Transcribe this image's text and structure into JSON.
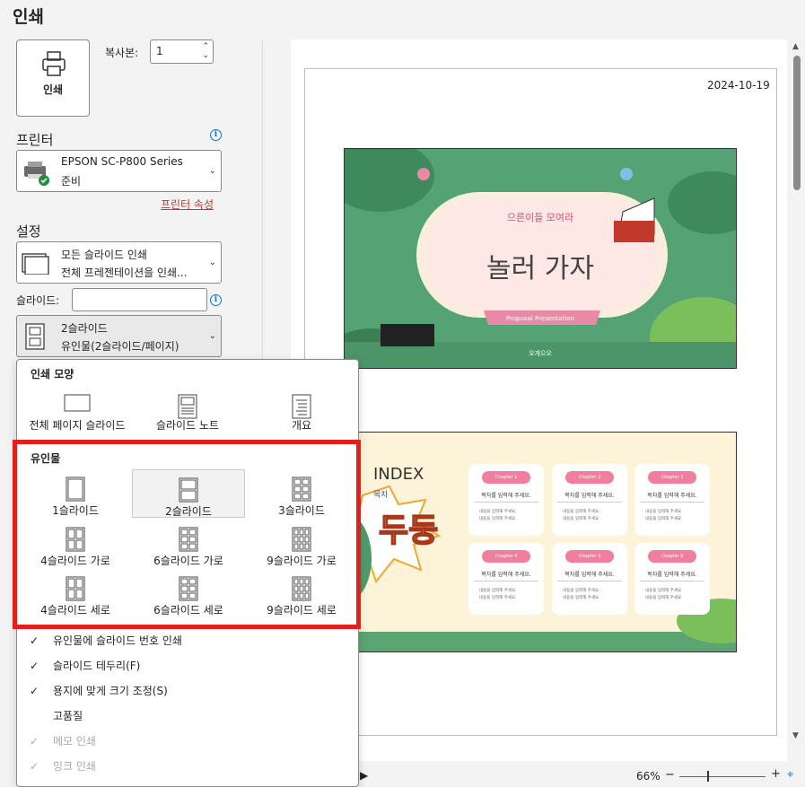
{
  "page_title": "인쇄",
  "print_button": {
    "label": "인쇄",
    "icon": "printer-icon"
  },
  "copies": {
    "label": "복사본:",
    "value": "1"
  },
  "printer": {
    "section": "프린터",
    "name": "EPSON SC-P800 Series",
    "status": "준비",
    "properties_link": "프린터 속성"
  },
  "settings": {
    "section": "설정",
    "range_line1": "모든 슬라이드 인쇄",
    "range_line2": "전체 프레젠테이션을 인쇄...",
    "slides_label": "슬라이드:",
    "slides_value": "",
    "layout_line1": "2슬라이드",
    "layout_line2": "유인물(2슬라이드/페이지)"
  },
  "popup": {
    "print_layout_header": "인쇄 모양",
    "print_layout_options": [
      "전체 페이지 슬라이드",
      "슬라이드 노트",
      "개요"
    ],
    "handouts_header": "유인물",
    "handout_options": [
      "1슬라이드",
      "2슬라이드",
      "3슬라이드",
      "4슬라이드 가로",
      "6슬라이드 가로",
      "9슬라이드 가로",
      "4슬라이드 세로",
      "6슬라이드 세로",
      "9슬라이드 세로"
    ],
    "selected_handout": "2슬라이드",
    "checks": [
      {
        "label": "유인물에 슬라이드 번호 인쇄",
        "checked": true,
        "disabled": false
      },
      {
        "label": "슬라이드 테두리(F)",
        "checked": true,
        "disabled": false
      },
      {
        "label": "용지에 맞게 크기 조정(S)",
        "checked": true,
        "disabled": false
      },
      {
        "label": "고품질",
        "checked": false,
        "disabled": false
      },
      {
        "label": "메모 인쇄",
        "checked": true,
        "disabled": true
      },
      {
        "label": "잉크 인쇄",
        "checked": true,
        "disabled": true
      }
    ]
  },
  "preview": {
    "date": "2024-10-19",
    "slide1": {
      "subtitle": "으른이들 모여라",
      "title": "놀러 가자",
      "ribbon": "Proposal Presentation",
      "author": "오개으오"
    },
    "slide2": {
      "title": "INDEX",
      "subtitle": "목차",
      "badge": "두둥",
      "chapters": [
        {
          "name": "Chapter 1",
          "heading": "목차를 입력해 주세요."
        },
        {
          "name": "Chapter 2",
          "heading": "목차를 입력해 주세요."
        },
        {
          "name": "Chapter 3",
          "heading": "목차를 입력해 주세요."
        },
        {
          "name": "Chapter 4",
          "heading": "목차를 입력해 주세요."
        },
        {
          "name": "Chapter 5",
          "heading": "목차를 입력해 주세요."
        },
        {
          "name": "Chapter 6",
          "heading": "목차를 입력해 주세요."
        }
      ],
      "bullet": "내용을 입력해 주세요."
    }
  },
  "zoom": {
    "value": "66%",
    "minus": "−",
    "plus": "+"
  },
  "colors": {
    "accent_red": "#e41d1d",
    "link": "#c0392b",
    "info": "#1a73c8"
  }
}
